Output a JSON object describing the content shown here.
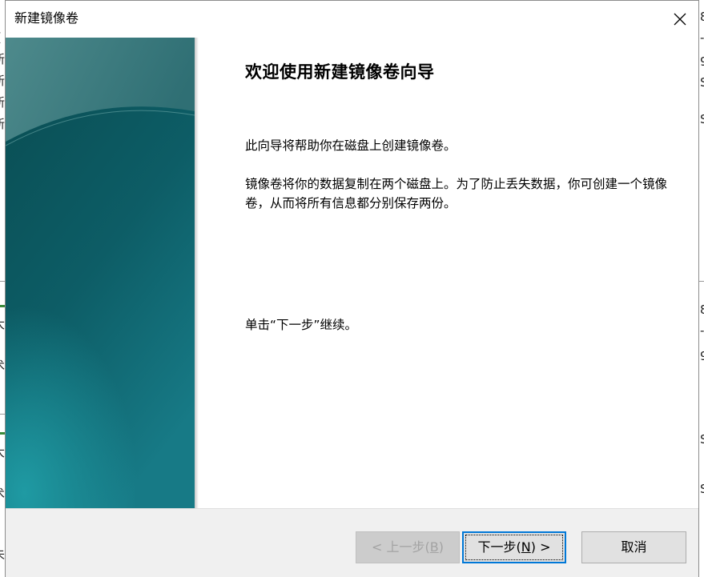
{
  "window": {
    "title": "新建镜像卷",
    "close_label": "×"
  },
  "background_fragments": {
    "left": [
      "(",
      "新",
      "新",
      "新",
      "新",
      "大",
      "0",
      "术",
      "大",
      "0",
      "术",
      "未"
    ],
    "right": [
      "8",
      "-",
      "9",
      "S",
      "S",
      "8",
      "-",
      "9",
      "S",
      "S"
    ]
  },
  "content": {
    "heading": "欢迎使用新建镜像卷向导",
    "paragraph1": "此向导将帮助你在磁盘上创建镜像卷。",
    "paragraph2": "镜像卷将你的数据复制在两个磁盘上。为了防止丢失数据，你可创建一个镜像卷，从而将所有信息都分别保存两份。",
    "paragraph3": "单击“下一步”继续。"
  },
  "buttons": {
    "back": {
      "prefix": "< 上一步(",
      "key": "B",
      "suffix": ")"
    },
    "next": {
      "prefix": "下一步(",
      "key": "N",
      "suffix": ") >"
    },
    "cancel": "取消"
  },
  "colors": {
    "banner_dark": "#0e5a63",
    "banner_light": "#157e8c",
    "focus_border": "#0078d7"
  }
}
